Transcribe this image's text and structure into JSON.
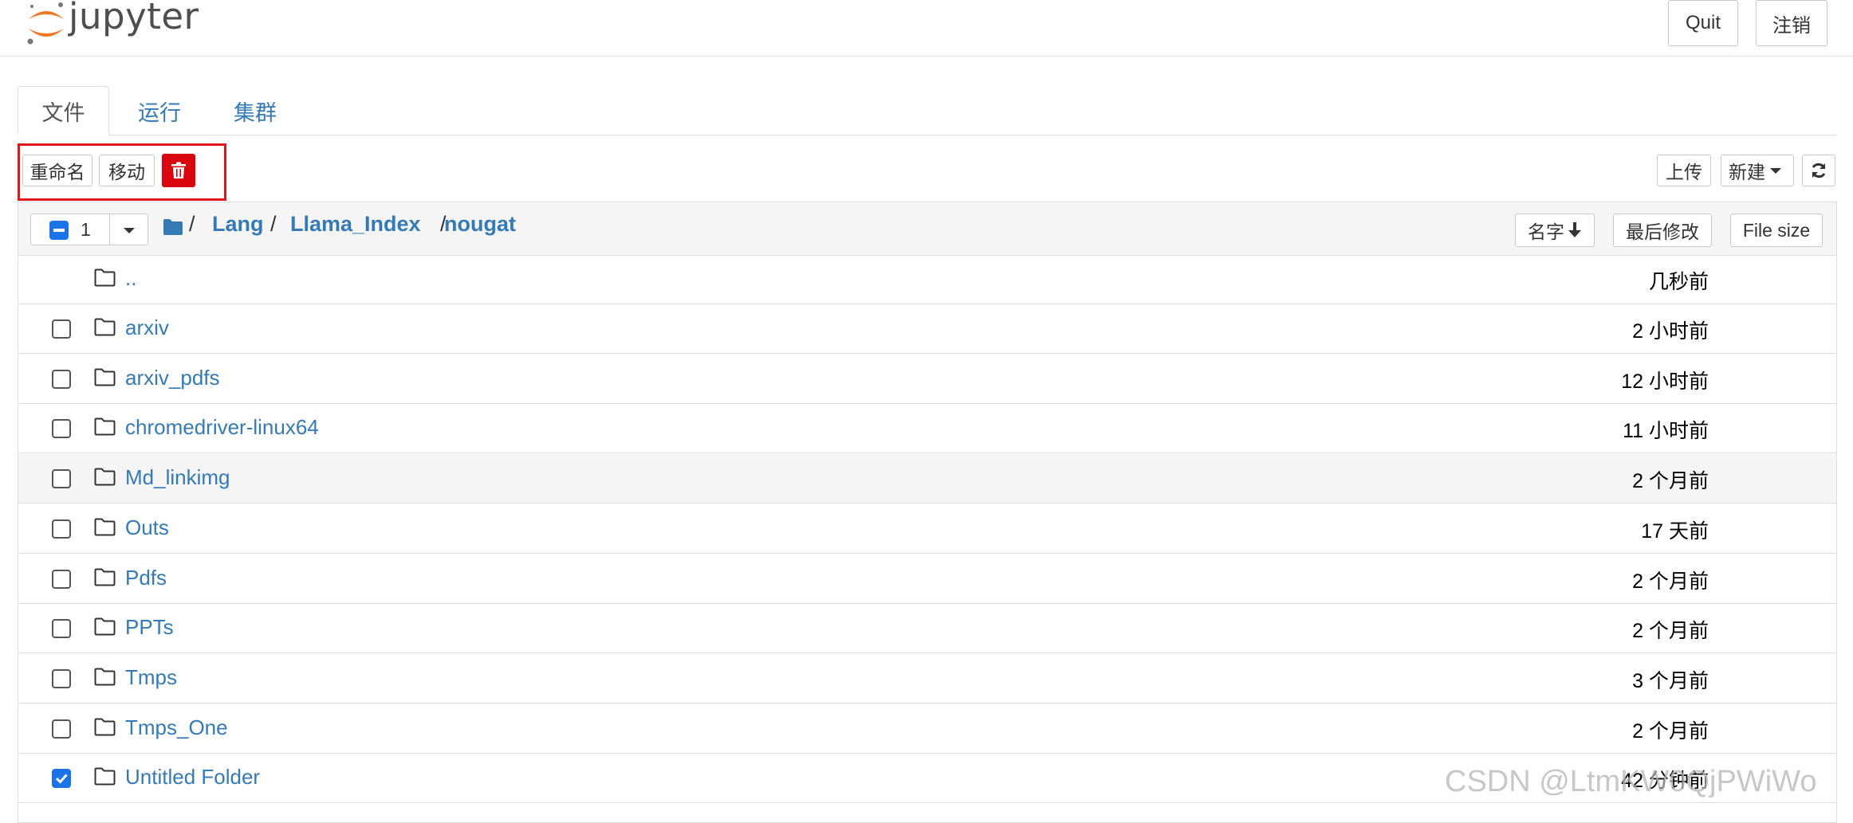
{
  "header": {
    "logo_text": "jupyter",
    "quit_label": "Quit",
    "logout_label": "注销"
  },
  "tabs": [
    {
      "label": "文件",
      "active": true
    },
    {
      "label": "运行",
      "active": false
    },
    {
      "label": "集群",
      "active": false
    }
  ],
  "toolbar": {
    "rename_label": "重命名",
    "move_label": "移动",
    "delete_icon": "trash-icon",
    "upload_label": "上传",
    "new_label": "新建",
    "refresh_icon": "refresh-icon"
  },
  "list_header": {
    "selected_count": "1",
    "breadcrumb": [
      "Lang",
      "Llama_Index",
      "nougat"
    ],
    "sort_name_label": "名字",
    "sort_modified_label": "最后修改",
    "sort_size_label": "File size"
  },
  "parent_row": {
    "name": "..",
    "time": "几秒前"
  },
  "rows": [
    {
      "name": "arxiv",
      "time": "2 小时前",
      "checked": false
    },
    {
      "name": "arxiv_pdfs",
      "time": "12 小时前",
      "checked": false
    },
    {
      "name": "chromedriver-linux64",
      "time": "11 小时前",
      "checked": false
    },
    {
      "name": "Md_linkimg",
      "time": "2 个月前",
      "checked": false
    },
    {
      "name": "Outs",
      "time": "17 天前",
      "checked": false
    },
    {
      "name": "Pdfs",
      "time": "2 个月前",
      "checked": false
    },
    {
      "name": "PPTs",
      "time": "2 个月前",
      "checked": false
    },
    {
      "name": "Tmps",
      "time": "3 个月前",
      "checked": false
    },
    {
      "name": "Tmps_One",
      "time": "2 个月前",
      "checked": false
    },
    {
      "name": "Untitled Folder",
      "time": "42 分钟前",
      "checked": true
    }
  ],
  "watermark": "CSDN @LtmKW0QjPWiWo",
  "colors": {
    "accent": "#337ab7",
    "danger": "#d9050f",
    "highlight": "#e3141c",
    "checkbox": "#1a73e8"
  }
}
